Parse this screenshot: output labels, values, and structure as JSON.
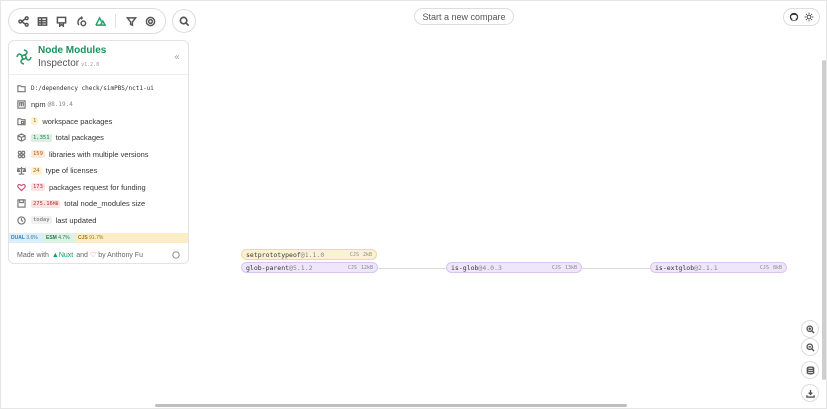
{
  "toolbar": {
    "buttons": [
      "graph-view-icon",
      "table-view-icon",
      "licenses-icon",
      "versions-icon",
      "nuxt-icon"
    ],
    "filter_icon": "filter-icon",
    "settings_icon": "settings-icon",
    "search_icon": "search-icon"
  },
  "compare_label": "Start a new compare",
  "top_right": {
    "github_icon": "github-icon",
    "theme_icon": "sun-icon"
  },
  "panel": {
    "title_1": "Node Modules",
    "title_2": "Inspector",
    "version": "v1.2.0",
    "path": "D:/dependency check/simPBS/nct1-ui",
    "package_manager": "npm",
    "pm_version": "@8.19.4",
    "workspace": {
      "count": "1",
      "label": "workspace packages"
    },
    "total": {
      "count": "1,351",
      "label": "total packages"
    },
    "multi": {
      "count": "159",
      "label": "libraries with multiple versions"
    },
    "licenses": {
      "count": "24",
      "label": "type of licenses"
    },
    "funding": {
      "count": "173",
      "label": "packages request for funding"
    },
    "size": {
      "value": "275.16",
      "unit": "MB",
      "label": "total node_modules size"
    },
    "updated": {
      "value": "today",
      "label": "last updated"
    },
    "formats": {
      "dual": {
        "label": "DUAL",
        "pct": "3.6%"
      },
      "esm": {
        "label": "ESM",
        "pct": "4.7%"
      },
      "cjs": {
        "label": "CJS",
        "pct": "91.7%"
      }
    },
    "footer": {
      "made_with": "Made with",
      "nuxt": "Nuxt",
      "and": "and",
      "by": "by Anthony Fu"
    }
  },
  "graph": {
    "nodes": [
      {
        "name": "setprototypeof",
        "version": "@1.1.0",
        "format": "CJS",
        "size": "2",
        "unit": "kB"
      },
      {
        "name": "glob-parent",
        "version": "@5.1.2",
        "format": "CJS",
        "size": "12",
        "unit": "kB"
      },
      {
        "name": "is-glob",
        "version": "@4.0.3",
        "format": "CJS",
        "size": "13",
        "unit": "kB"
      },
      {
        "name": "is-extglob",
        "version": "@2.1.1",
        "format": "CJS",
        "size": "8",
        "unit": "kB"
      }
    ]
  },
  "controls": [
    "zoom-in-icon",
    "zoom-out-icon",
    "database-icon",
    "download-icon"
  ]
}
